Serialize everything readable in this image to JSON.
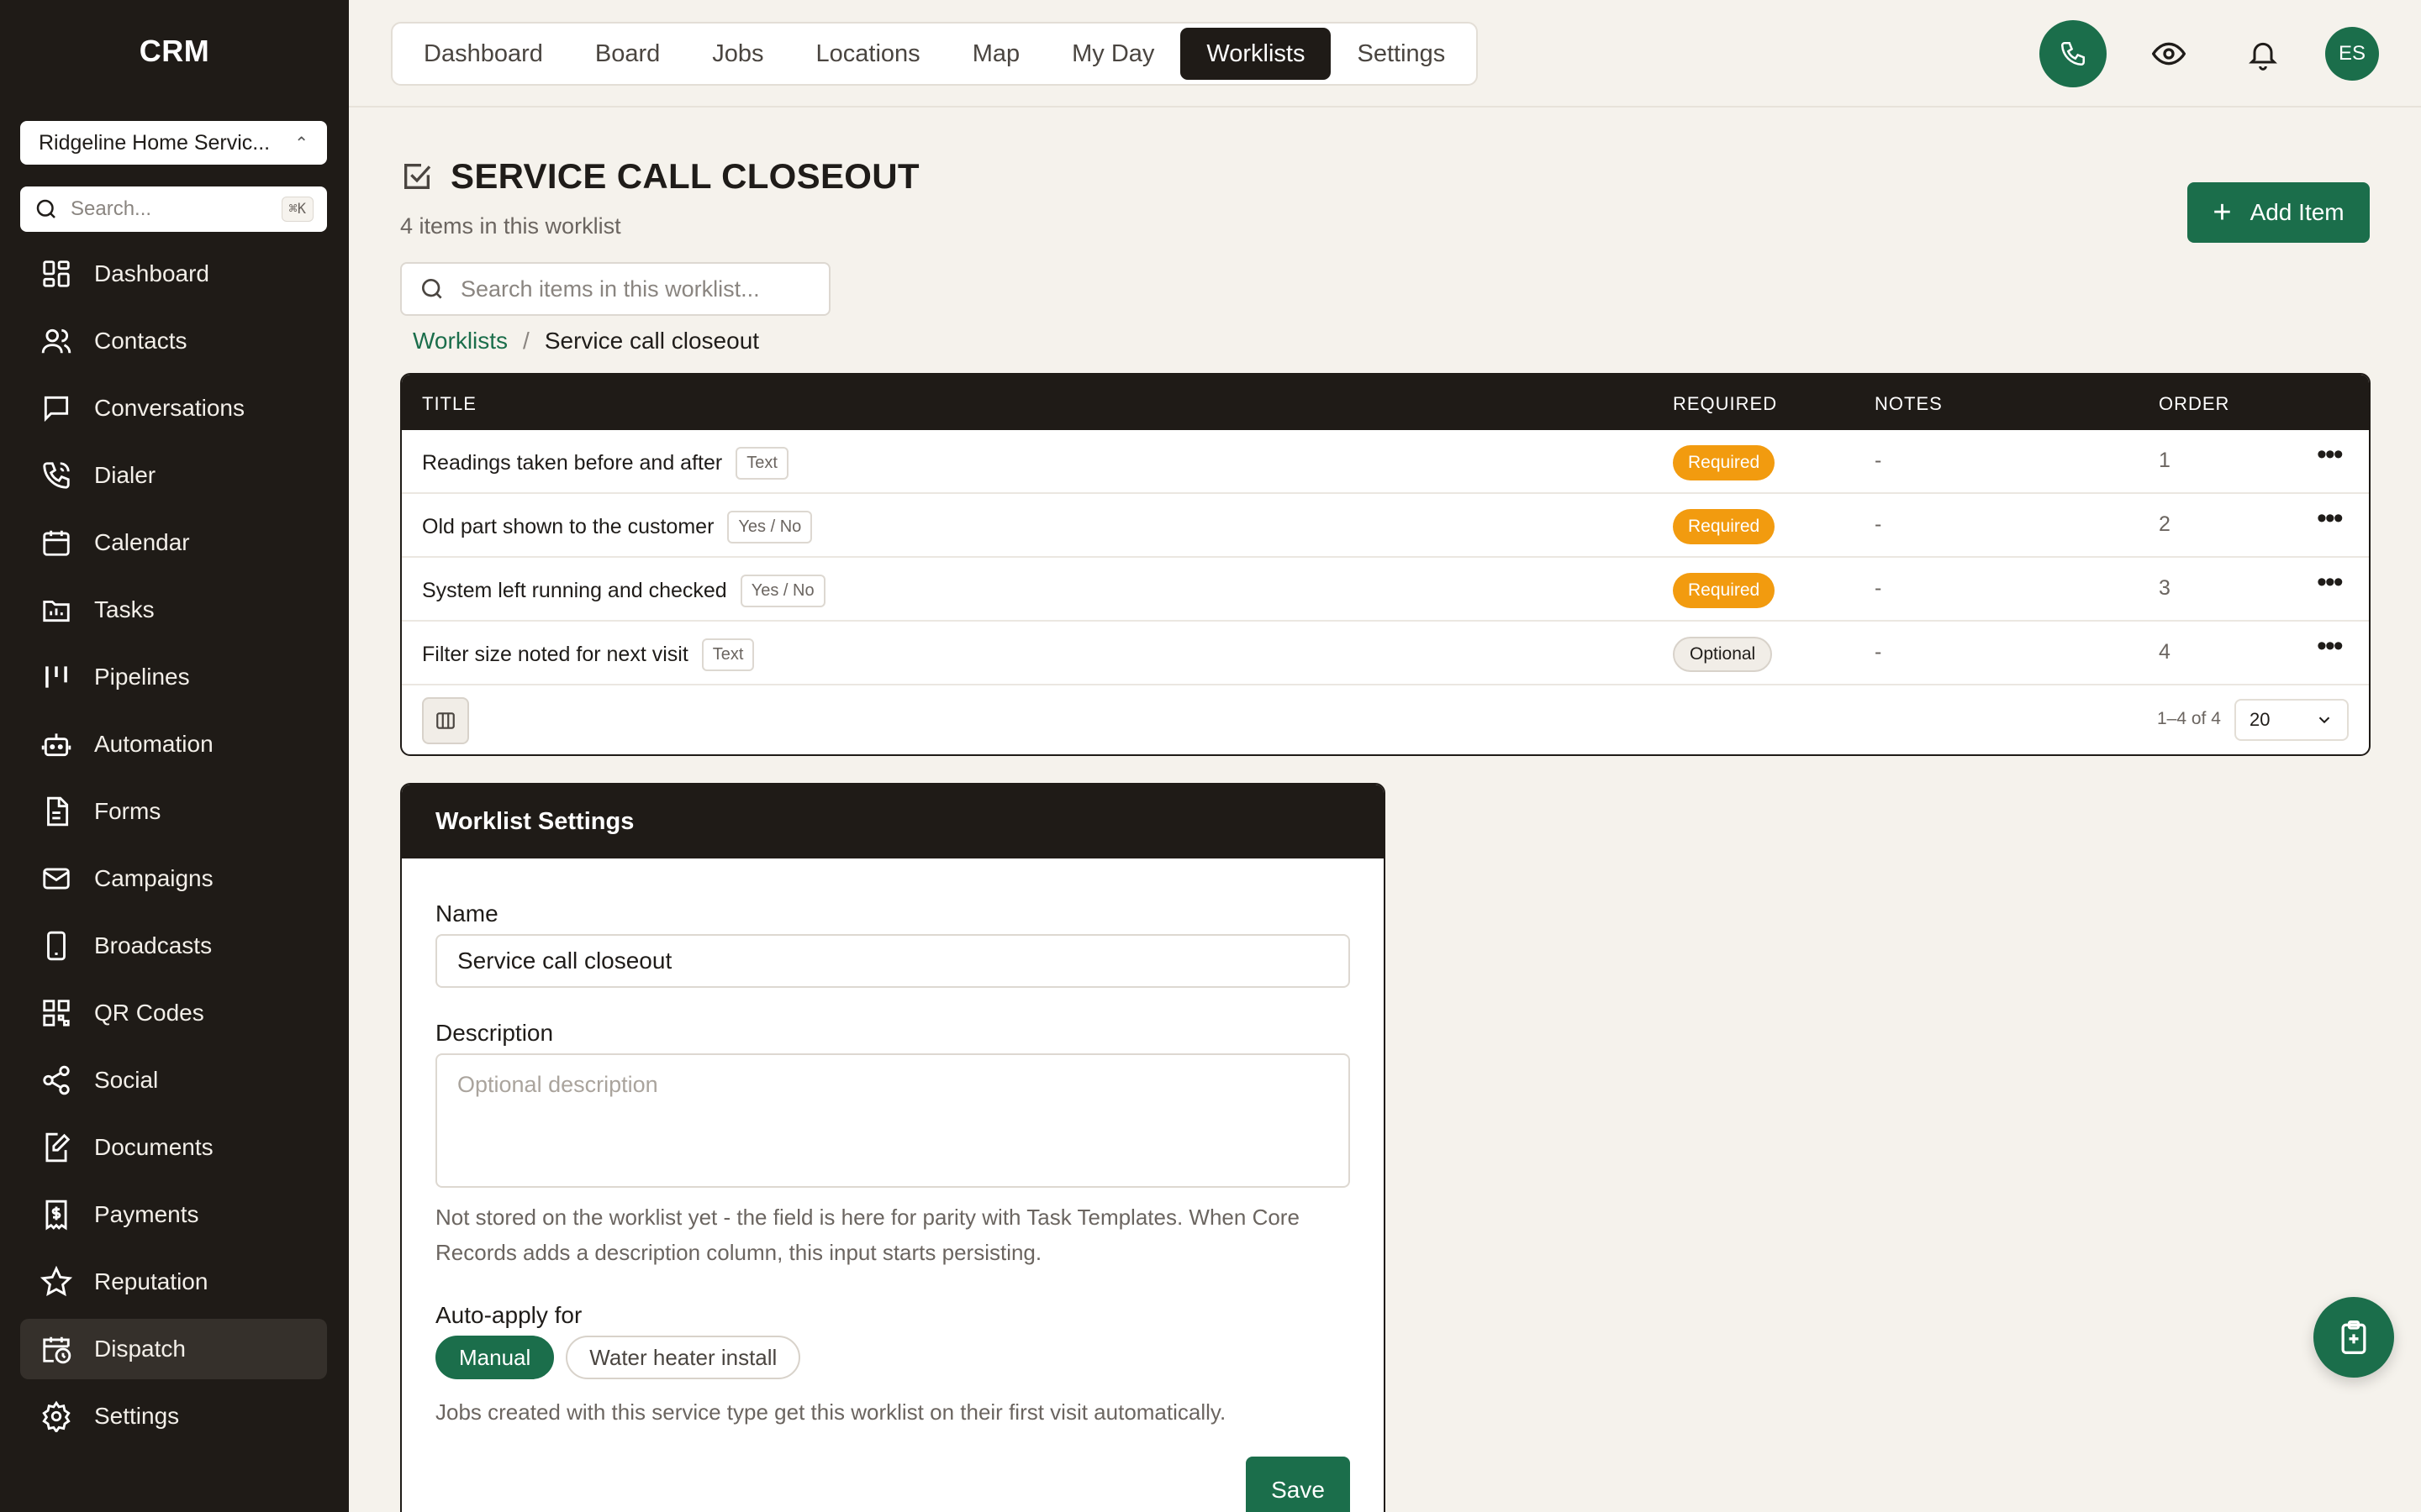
{
  "sidebar": {
    "brand": "CRM",
    "account": "Ridgeline Home Servic...",
    "search_placeholder": "Search...",
    "search_shortcut": "⌘K",
    "items": [
      {
        "label": "Dashboard",
        "icon": "dashboard-icon"
      },
      {
        "label": "Contacts",
        "icon": "users-icon"
      },
      {
        "label": "Conversations",
        "icon": "chat-icon"
      },
      {
        "label": "Dialer",
        "icon": "phone-icon"
      },
      {
        "label": "Calendar",
        "icon": "calendar-icon"
      },
      {
        "label": "Tasks",
        "icon": "folder-icon"
      },
      {
        "label": "Pipelines",
        "icon": "pipeline-icon"
      },
      {
        "label": "Automation",
        "icon": "robot-icon"
      },
      {
        "label": "Forms",
        "icon": "form-icon"
      },
      {
        "label": "Campaigns",
        "icon": "mail-icon"
      },
      {
        "label": "Broadcasts",
        "icon": "mobile-icon"
      },
      {
        "label": "QR Codes",
        "icon": "qr-icon"
      },
      {
        "label": "Social",
        "icon": "share-icon"
      },
      {
        "label": "Documents",
        "icon": "document-edit-icon"
      },
      {
        "label": "Payments",
        "icon": "receipt-icon"
      },
      {
        "label": "Reputation",
        "icon": "star-icon"
      },
      {
        "label": "Dispatch",
        "icon": "calendar-clock-icon",
        "active": true
      },
      {
        "label": "Settings",
        "icon": "gear-icon"
      }
    ]
  },
  "topnav": {
    "tabs": [
      "Dashboard",
      "Board",
      "Jobs",
      "Locations",
      "Map",
      "My Day",
      "Worklists",
      "Settings"
    ],
    "active_tab": "Worklists",
    "avatar_initials": "ES"
  },
  "page": {
    "title": "SERVICE CALL CLOSEOUT",
    "subtitle": "4 items in this worklist",
    "add_button": "Add Item",
    "search_placeholder": "Search items in this worklist...",
    "breadcrumb": {
      "root": "Worklists",
      "separator": "/",
      "current": "Service call closeout"
    }
  },
  "table": {
    "columns": {
      "title": "TITLE",
      "required": "REQUIRED",
      "notes": "NOTES",
      "order": "ORDER"
    },
    "rows": [
      {
        "title": "Readings taken before and after",
        "type": "Text",
        "required": "Required",
        "notes": "-",
        "order": "1"
      },
      {
        "title": "Old part shown to the customer",
        "type": "Yes / No",
        "required": "Required",
        "notes": "-",
        "order": "2"
      },
      {
        "title": "System left running and checked",
        "type": "Yes / No",
        "required": "Required",
        "notes": "-",
        "order": "3"
      },
      {
        "title": "Filter size noted for next visit",
        "type": "Text",
        "required": "Optional",
        "notes": "-",
        "order": "4"
      }
    ],
    "pagination": {
      "info": "1–4 of 4",
      "page_size": "20"
    }
  },
  "settings": {
    "header": "Worklist Settings",
    "name_label": "Name",
    "name_value": "Service call closeout",
    "description_label": "Description",
    "description_placeholder": "Optional description",
    "description_help": "Not stored on the worklist yet - the field is here for parity with Task Templates. When Core Records adds a description column, this input starts persisting.",
    "auto_apply_label": "Auto-apply for",
    "auto_apply_options": [
      {
        "label": "Manual",
        "selected": true
      },
      {
        "label": "Water heater install",
        "selected": false
      }
    ],
    "auto_apply_help": "Jobs created with this service type get this worklist on their first visit automatically.",
    "save_button": "Save"
  },
  "colors": {
    "brand_green": "#1b6e4b",
    "sidebar_bg": "#1f1b17",
    "required_orange": "#f29b0f",
    "page_bg": "#f5f2ec"
  }
}
